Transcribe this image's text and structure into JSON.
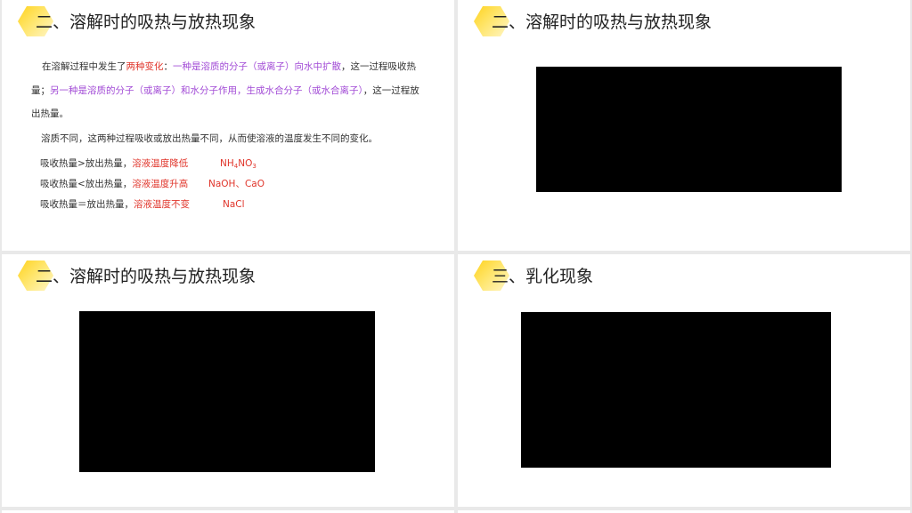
{
  "slides": [
    {
      "title": "二、溶解时的吸热与放热现象",
      "paragraph1": {
        "intro": "在溶解过程中发生了",
        "highlight": "两种变化",
        "colon": "：",
        "part1": "一种是溶质的分子（或离子）向水中扩散",
        "mid": "，这一过程吸收热量；",
        "part2": "另一种是溶质的分子（或离子）和水分子作用，生成水合分子（或水合离子）",
        "end": "，这一过程放出热量。"
      },
      "paragraph2": "溶质不同，这两种过程吸收或放出热量不同，从而使溶液的温度发生不同的变化。",
      "rows": [
        {
          "condition": "吸收热量>放出热量，",
          "result": "溶液温度降低",
          "formula_main": "NH",
          "formula_sub": "4",
          "formula_tail": "NO",
          "formula_sub2": "3"
        },
        {
          "condition": "吸收热量<放出热量，",
          "result": "溶液温度升高",
          "formula": "NaOH、CaO"
        },
        {
          "condition": "吸收热量＝放出热量，",
          "result": "溶液温度不变",
          "formula": "NaCl"
        }
      ]
    },
    {
      "title": "二、溶解时的吸热与放热现象"
    },
    {
      "title": "二、溶解时的吸热与放热现象"
    },
    {
      "title": "三、乳化现象"
    }
  ],
  "colors": {
    "accent_red": "#e0352b",
    "accent_purple": "#a24bd6",
    "hex_yellow": "#ffd21e",
    "video_black": "#000000"
  }
}
